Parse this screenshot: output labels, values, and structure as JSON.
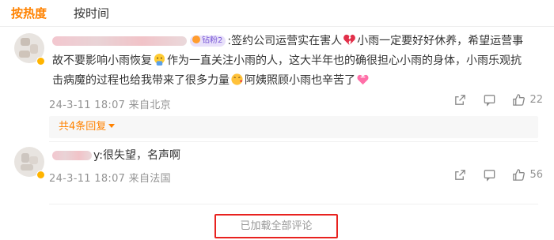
{
  "tabs": {
    "hot": "按热度",
    "time": "按时间"
  },
  "comment1": {
    "user_vip": "钻粉2",
    "text_a": ":签约公司运营实在害人",
    "text_b": "小雨一定要好好休养，希望运营事故不要影响小雨恢复",
    "text_c": "作为一直关注小雨的人，这大半年也的确很担心小雨的身体，小雨乐观抗击病魔的过程也给我带来了很多力量",
    "text_d": "阿姨照顾小雨也辛苦了",
    "meta": "24-3-11 18:07 来自北京",
    "likes": "22",
    "replies": "共4条回复"
  },
  "comment2": {
    "username_suffix": "y",
    "text": ":很失望，名声啊",
    "meta": "24-3-11 18:07 来自法国",
    "likes": "56"
  },
  "load_all": "已加载全部评论",
  "icons": {
    "emo1": "broken-heart-icon",
    "emo2": "praying-emoji-icon",
    "emo3": "kiss-emoji-icon",
    "emo4": "heart-gift-icon",
    "share": "share-icon",
    "comment": "comment-icon",
    "like": "thumbs-up-icon"
  },
  "colors": {
    "accent": "#ff8200",
    "highlight_border": "#e8221f",
    "muted": "#939393"
  }
}
